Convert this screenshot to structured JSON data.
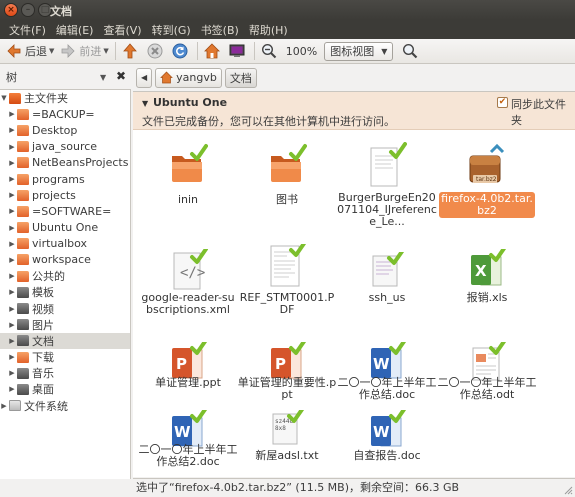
{
  "window": {
    "title": "文档"
  },
  "menu": [
    "文件(F)",
    "编辑(E)",
    "查看(V)",
    "转到(G)",
    "书签(B)",
    "帮助(H)"
  ],
  "toolbar": {
    "back": "后退",
    "forward": "前进",
    "zoom": "100%",
    "view_mode": "图标视图"
  },
  "sidebar": {
    "header": "树",
    "items": [
      {
        "label": "主文件夹",
        "icon": "home-folder-icon",
        "expanded": true
      },
      {
        "label": "=BACKUP="
      },
      {
        "label": "Desktop"
      },
      {
        "label": "java_source"
      },
      {
        "label": "NetBeansProjects"
      },
      {
        "label": "programs"
      },
      {
        "label": "projects"
      },
      {
        "label": "=SOFTWARE="
      },
      {
        "label": "Ubuntu One"
      },
      {
        "label": "virtualbox"
      },
      {
        "label": "workspace"
      },
      {
        "label": "公共的"
      },
      {
        "label": "模板"
      },
      {
        "label": "视频"
      },
      {
        "label": "图片"
      },
      {
        "label": "文档"
      },
      {
        "label": "下载"
      },
      {
        "label": "音乐"
      },
      {
        "label": "桌面"
      },
      {
        "label": "文件系统"
      }
    ]
  },
  "location": {
    "crumbs": [
      "yangvb",
      "文档"
    ]
  },
  "ubuntu_one": {
    "title": "Ubuntu One",
    "description": "文件已完成备份，您可以在其他计算机中进行访问。",
    "sync_label": "同步此文件夹"
  },
  "files": [
    {
      "name": "inin",
      "icon": "folder-icon"
    },
    {
      "name": "图书",
      "icon": "folder-icon"
    },
    {
      "name": "BurgerBurgeEn20071104_IJreference_Le...",
      "icon": "document-icon"
    },
    {
      "name": "firefox-4.0b2.tar.bz2",
      "icon": "archive-icon",
      "badge": "tar.bz2",
      "selected": true
    },
    {
      "name": "google-reader-subscriptions.xml",
      "icon": "xml-icon"
    },
    {
      "name": "REF_STMT0001.PDF",
      "icon": "pdf-icon"
    },
    {
      "name": "ssh_us",
      "icon": "text-file-icon"
    },
    {
      "name": "报销.xls",
      "icon": "spreadsheet-icon"
    },
    {
      "name": "单证管理.ppt",
      "icon": "presentation-icon"
    },
    {
      "name": "单证管理的重要性.ppt",
      "icon": "presentation-icon"
    },
    {
      "name": "二〇一〇年上半年工作总结.doc",
      "icon": "word-icon"
    },
    {
      "name": "二〇一〇年上半年工作总结.odt",
      "icon": "odt-icon"
    },
    {
      "name": "二〇一〇年上半年工作总结2.doc",
      "icon": "word-icon"
    },
    {
      "name": "新屋adsl.txt",
      "icon": "text-file-icon",
      "preview": "sz448\n8x8"
    },
    {
      "name": "自查报告.doc",
      "icon": "word-icon"
    }
  ],
  "status": {
    "text": "选中了“firefox-4.0b2.tar.bz2” (11.5 MB)，剩余空间：66.3 GB"
  },
  "colors": {
    "accent": "#f18a4b",
    "ubuntu_one_bg": "#f6e5d6",
    "menubar": "#3c3b37",
    "sync_check": "#7bbf2c"
  }
}
